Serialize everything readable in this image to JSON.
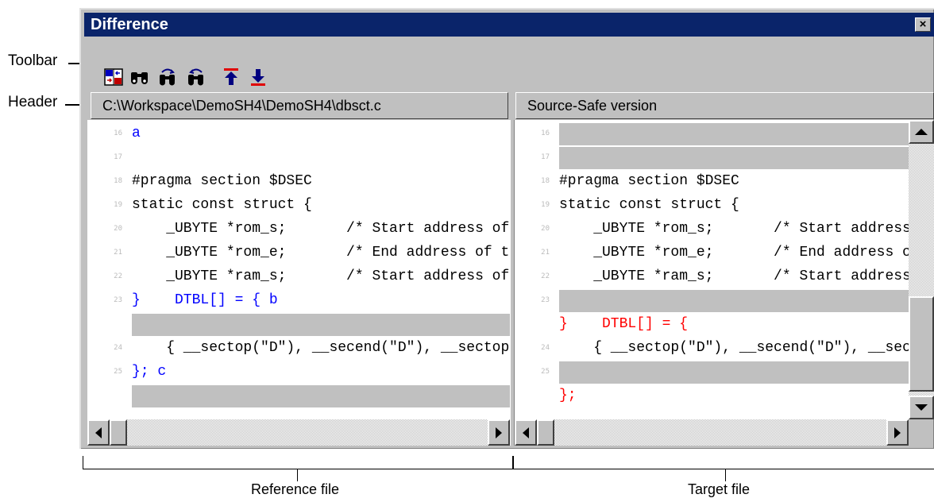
{
  "callouts": {
    "toolbar": "Toolbar",
    "header": "Header",
    "reference": "Reference file",
    "target": "Target file"
  },
  "window": {
    "title": "Difference",
    "close_glyph": "×"
  },
  "toolbar": {
    "buttons": [
      {
        "name": "toggle-view-icon"
      },
      {
        "name": "find-icon"
      },
      {
        "name": "find-previous-icon"
      },
      {
        "name": "find-next-icon"
      },
      {
        "name": "previous-difference-icon"
      },
      {
        "name": "next-difference-icon"
      }
    ]
  },
  "reference": {
    "header": "C:\\Workspace\\DemoSH4\\DemoSH4\\dbsct.c",
    "lines": [
      {
        "num": "16",
        "text": "a",
        "color": "#0000ff"
      },
      {
        "num": "17",
        "text": "",
        "color": "#000000"
      },
      {
        "num": "18",
        "text": "#pragma section $DSEC",
        "color": "#000000"
      },
      {
        "num": "19",
        "text": "static const struct {",
        "color": "#000000"
      },
      {
        "num": "20",
        "text": "    _UBYTE *rom_s;       /* Start address of the initialized data section in ROM */",
        "color": "#000000"
      },
      {
        "num": "21",
        "text": "    _UBYTE *rom_e;       /* End address of the initialized data section in ROM */",
        "color": "#000000"
      },
      {
        "num": "22",
        "text": "    _UBYTE *ram_s;       /* Start address of the initialized data section in RAM */",
        "color": "#000000"
      },
      {
        "num": "23",
        "text": "}    DTBL[] = { b",
        "color": "#0000ff"
      },
      {
        "num": "",
        "text": "",
        "color": "#000000",
        "gap": true
      },
      {
        "num": "24",
        "text": "    { __sectop(\"D\"), __secend(\"D\"), __sectop(\"R\") }",
        "color": "#000000"
      },
      {
        "num": "25",
        "text": "}; c",
        "color": "#0000ff"
      },
      {
        "num": "",
        "text": "",
        "color": "#000000",
        "gap": true
      }
    ]
  },
  "target": {
    "header": "Source-Safe version",
    "lines": [
      {
        "num": "16",
        "text": "",
        "color": "#000000",
        "gap": true
      },
      {
        "num": "17",
        "text": "",
        "color": "#000000",
        "gap": true
      },
      {
        "num": "18",
        "text": "#pragma section $DSEC",
        "color": "#000000"
      },
      {
        "num": "19",
        "text": "static const struct {",
        "color": "#000000"
      },
      {
        "num": "20",
        "text": "    _UBYTE *rom_s;       /* Start address of the initialized data section in ROM */",
        "color": "#000000"
      },
      {
        "num": "21",
        "text": "    _UBYTE *rom_e;       /* End address of the initialized data section in ROM */",
        "color": "#000000"
      },
      {
        "num": "22",
        "text": "    _UBYTE *ram_s;       /* Start address of the initialized data section in RAM */",
        "color": "#000000"
      },
      {
        "num": "23",
        "text": "",
        "color": "#000000",
        "gap": true
      },
      {
        "num": "",
        "text": "}    DTBL[] = {",
        "color": "#ff0000"
      },
      {
        "num": "24",
        "text": "    { __sectop(\"D\"), __secend(\"D\"), __sectop(\"R\") }",
        "color": "#000000"
      },
      {
        "num": "25",
        "text": "",
        "color": "#000000",
        "gap": true
      },
      {
        "num": "",
        "text": "};",
        "color": "#ff0000"
      }
    ]
  }
}
